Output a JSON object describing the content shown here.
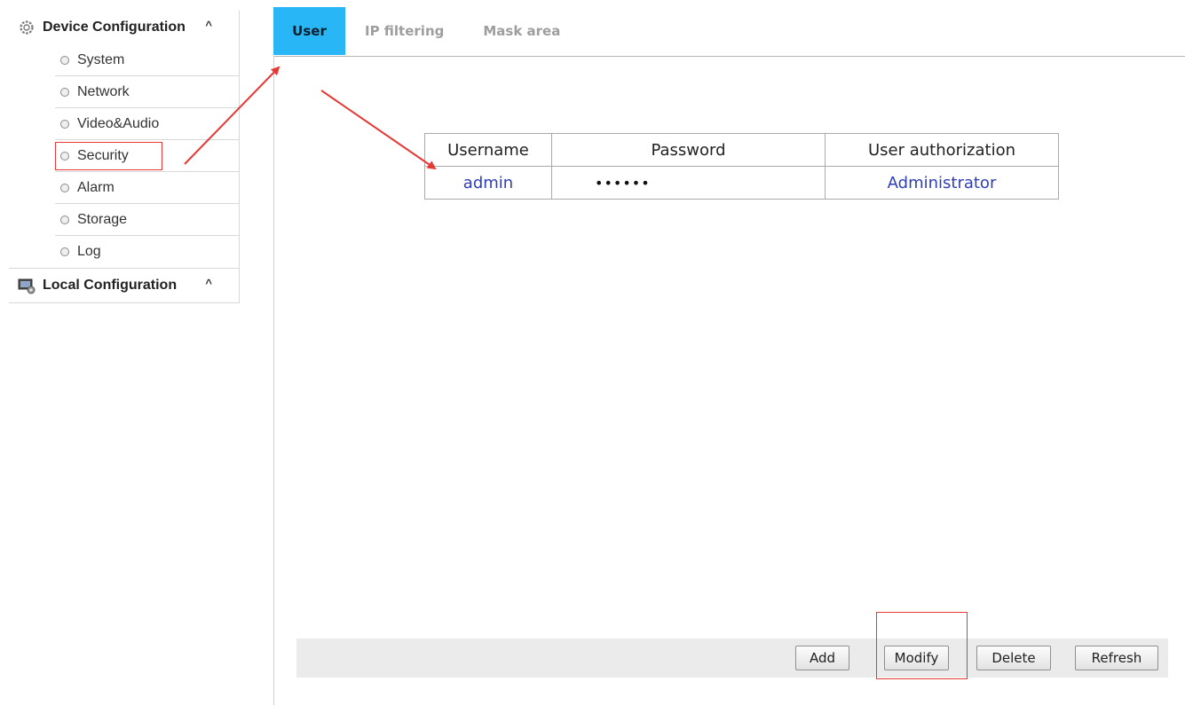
{
  "sidebar": {
    "device_group": {
      "label": "Device Configuration",
      "icon": "gear-icon",
      "caret": "^"
    },
    "items": [
      {
        "label": "System"
      },
      {
        "label": "Network"
      },
      {
        "label": "Video&Audio"
      },
      {
        "label": "Security",
        "selected": true
      },
      {
        "label": "Alarm"
      },
      {
        "label": "Storage"
      },
      {
        "label": "Log"
      }
    ],
    "local_group": {
      "label": "Local Configuration",
      "icon": "monitor-settings-icon",
      "caret": "^"
    }
  },
  "tabs": [
    {
      "label": "User",
      "active": true
    },
    {
      "label": "IP filtering"
    },
    {
      "label": "Mask area"
    }
  ],
  "user_table": {
    "headers": [
      "Username",
      "Password",
      "User authorization"
    ],
    "rows": [
      {
        "username": "admin",
        "password": "••••••",
        "authorization": "Administrator"
      }
    ]
  },
  "actions": {
    "add": "Add",
    "modify": "Modify",
    "delete": "Delete",
    "refresh": "Refresh"
  },
  "colors": {
    "active_tab": "#29b6f6",
    "link_text": "#2e3db8",
    "annotation_red": "#e53935"
  }
}
